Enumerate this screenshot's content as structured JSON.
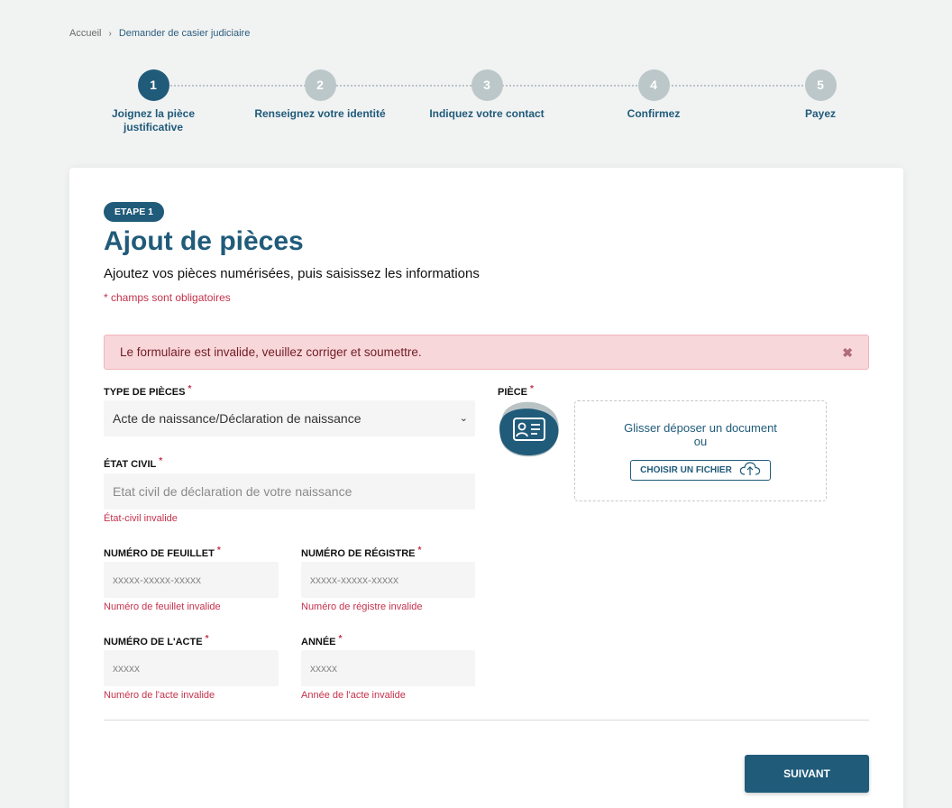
{
  "breadcrumb": {
    "home": "Accueil",
    "separator": "›",
    "current": "Demander de casier judiciaire"
  },
  "stepper": {
    "steps": [
      {
        "number": "1",
        "label": "Joignez la pièce justificative",
        "active": true
      },
      {
        "number": "2",
        "label": "Renseignez votre identité",
        "active": false
      },
      {
        "number": "3",
        "label": "Indiquez votre contact",
        "active": false
      },
      {
        "number": "4",
        "label": "Confirmez",
        "active": false
      },
      {
        "number": "5",
        "label": "Payez",
        "active": false
      }
    ]
  },
  "header": {
    "badge": "ETAPE 1",
    "title": "Ajout de pièces",
    "subtitle": "Ajoutez vos pièces numérisées, puis saisissez les informations",
    "required_note": "* champs sont obligatoires"
  },
  "alert": {
    "message": "Le formulaire est invalide, veuillez corriger et soumettre.",
    "close": "✖"
  },
  "form": {
    "required_marker": "*",
    "type_pieces": {
      "label": "TYPE DE PIÈCES",
      "value": "Acte de naissance/Déclaration de naissance",
      "chevron": "⌄"
    },
    "etat_civil": {
      "label": "ÉTAT CIVIL",
      "placeholder": "Etat civil de déclaration de votre naissance",
      "error": "État-civil invalide"
    },
    "numero_feuillet": {
      "label": "NUMÉRO DE FEUILLET",
      "placeholder": "xxxxx-xxxxx-xxxxx",
      "error": "Numéro de feuillet invalide"
    },
    "numero_registre": {
      "label": "NUMÉRO DE RÉGISTRE",
      "placeholder": "xxxxx-xxxxx-xxxxx",
      "error": "Numéro de régistre invalide"
    },
    "numero_acte": {
      "label": "NUMÉRO DE L'ACTE",
      "placeholder": "xxxxx",
      "error": "Numéro de l'acte invalide"
    },
    "annee": {
      "label": "ANNÉE",
      "placeholder": "xxxxx",
      "error": "Année de l'acte invalide"
    },
    "piece": {
      "label": "PIÈCE",
      "dropzone_line1": "Glisser déposer un document",
      "dropzone_line2": "ou",
      "button": "CHOISIR UN FICHIER"
    }
  },
  "actions": {
    "next": "SUIVANT"
  },
  "colors": {
    "primary": "#205b7a",
    "error": "#c4314b",
    "alert_bg": "#f8d7da",
    "step_inactive": "#bcc7c9"
  },
  "icons": {
    "piece": "id-card-icon",
    "upload": "cloud-upload-icon",
    "close": "close-icon",
    "chevron": "chevron-down-icon"
  }
}
